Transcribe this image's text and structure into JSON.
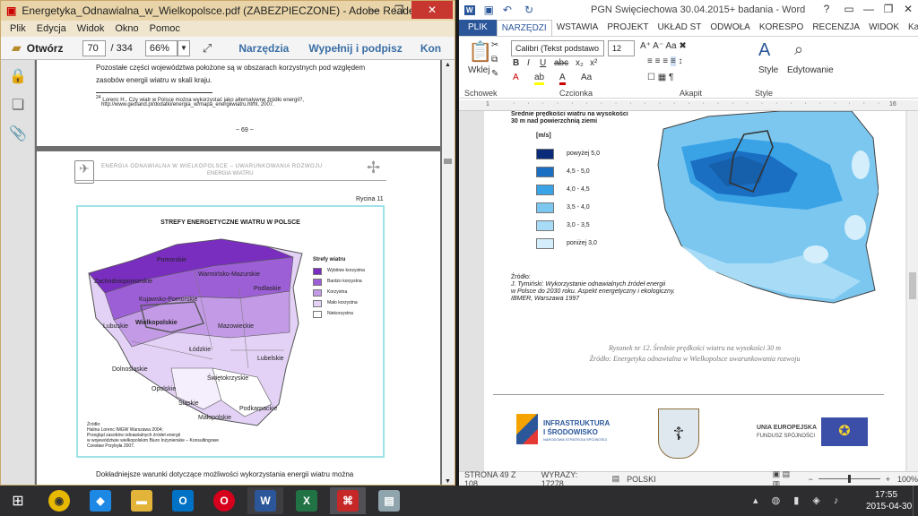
{
  "reader": {
    "title": "Energetyka_Odnawialna_w_Wielkopolsce.pdf (ZABEZPIECZONE) - Adobe Reader",
    "menu": [
      "Plik",
      "Edycja",
      "Widok",
      "Okno",
      "Pomoc"
    ],
    "toolbar": {
      "open": "Otwórz",
      "page_current": "70",
      "page_total": "/ 334",
      "zoom": "66%",
      "tools": "Narzędzia",
      "fill_sign": "Wypełnij i podpisz",
      "comment": "Kon"
    },
    "page1": {
      "line1": "Pozostałe części województwa położone są w obszarach korzystnych pod względem",
      "line2": "zasobów energii wiatru w skali kraju.",
      "footnote_num": "24",
      "footnote": "Lorenc H., Czy wiatr w Polsce można wykorzystać jako alternatywne źródło energii?,",
      "footnote2": "http://www.geoland.pl/dodatki/energia_w/mapa_energiiwiatru.html, 2007.",
      "page_num": "~ 69 ~"
    },
    "page2": {
      "header1": "ENERGIA ODNAWIALNA W WIELKOPOLSCE – UWARUNKOWANIA ROZWOJU",
      "header2": "ENERGIA WIATRU",
      "figure_no": "Rycina 11",
      "map_title": "STREFY ENERGETYCZNE WIATRU W POLSCE",
      "legend_title": "Strefy wiatru",
      "legend": [
        "Wybitnie korzystna",
        "Bardzo korzystna",
        "Korzystna",
        "Mało korzystna",
        "Niekorzystna"
      ],
      "regions": [
        "Pomorskie",
        "Zachodniopomorskie",
        "Warmińsko-Mazurskie",
        "Podlaskie",
        "Kujawsko-Pomorskie",
        "Lubuskie",
        "Wielkopolskie",
        "Mazowieckie",
        "Łódzkie",
        "Lubelskie",
        "Dolnośląskie",
        "Opolskie",
        "Świętokrzyskie",
        "Śląskie",
        "Małopolskie",
        "Podkarpackie"
      ],
      "source1": "Źródło:",
      "source2": "Halina Lorenc IMGW Warszawa 2004;",
      "source3": "Przegląd zasobów odnawialnych źródeł energii",
      "source4": "w województwie wielkopolskim Biuro Inżynierskie – Konsultingowe",
      "source5": "Czesław Przybyła 2007.",
      "bottom_text": "Dokładniejsze warunki dotyczące możliwości wykorzystania energii wiatru można"
    },
    "colors": {
      "strongest": "#7a2ec0",
      "very": "#9d5fd6",
      "good": "#c39ae6",
      "low": "#e3d2f5",
      "none": "#ffffff"
    }
  },
  "word": {
    "title": "PGN Święciechowa 30.04.2015+ badania - Word",
    "tabs": [
      "PLIK",
      "NARZĘDZI",
      "WSTAWIA",
      "PROJEKT",
      "UKŁAD ST",
      "ODWOŁA",
      "KORESPO",
      "RECENZJA",
      "WIDOK"
    ],
    "user": "Kamila Ję...",
    "font": "Calibri (Tekst podstawo",
    "size": "12",
    "groups": {
      "clipboard": "Schowek",
      "font": "Czcionka",
      "paragraph": "Akapit",
      "styles": "Style"
    },
    "paste": "Wklej",
    "style_btn": "Style",
    "edit_btn": "Edytowanie",
    "ruler_left": "1",
    "ruler_right": "16",
    "map": {
      "heading1": "Średnie prędkości wiatru na wysokości",
      "heading2": "30 m nad powierzchnią ziemi",
      "unit": "[m/s]",
      "legend": [
        "powyżej 5,0",
        "4,5 - 5,0",
        "4,0 - 4,5",
        "3,5 - 4,0",
        "3,0 - 3,5",
        "poniżej 3,0"
      ],
      "source1": "Źródło:",
      "source2": "J. Tymiński: Wykorzystanie odnawialnych źródeł energii",
      "source3": "w Polsce do 2030 roku. Aspekt energetyczny i ekologiczny.",
      "source4": "IBMER, Warszawa 1997"
    },
    "caption1": "Rysunek nr 12. Średnie prędkości wiatru na wysokości 30 m",
    "caption2": "Źródło: Energetyka odnawialna w Wielkopolsce uwarunkowania rozwoju",
    "logos": {
      "infra1": "INFRASTRUKTURA",
      "infra2": "I ŚRODOWISKO",
      "infra3": "NARODOWA STRATEGIA SPÓJNOŚCI",
      "eu1": "UNIA EUROPEJSKA",
      "eu2": "FUNDUSZ SPÓJNOŚCI"
    },
    "status": {
      "page": "STRONA 49 Z 108",
      "words": "WYRAZY: 17278",
      "lang": "POLSKI",
      "zoom": "100%"
    },
    "colors": {
      "c1": "#0a2a7a",
      "c2": "#1a6fc2",
      "c3": "#3aa3e6",
      "c4": "#7cc7f0",
      "c5": "#a8dcf6",
      "c6": "#d4eefb"
    }
  },
  "taskbar": {
    "time": "17:55",
    "date": "2015-04-30"
  }
}
